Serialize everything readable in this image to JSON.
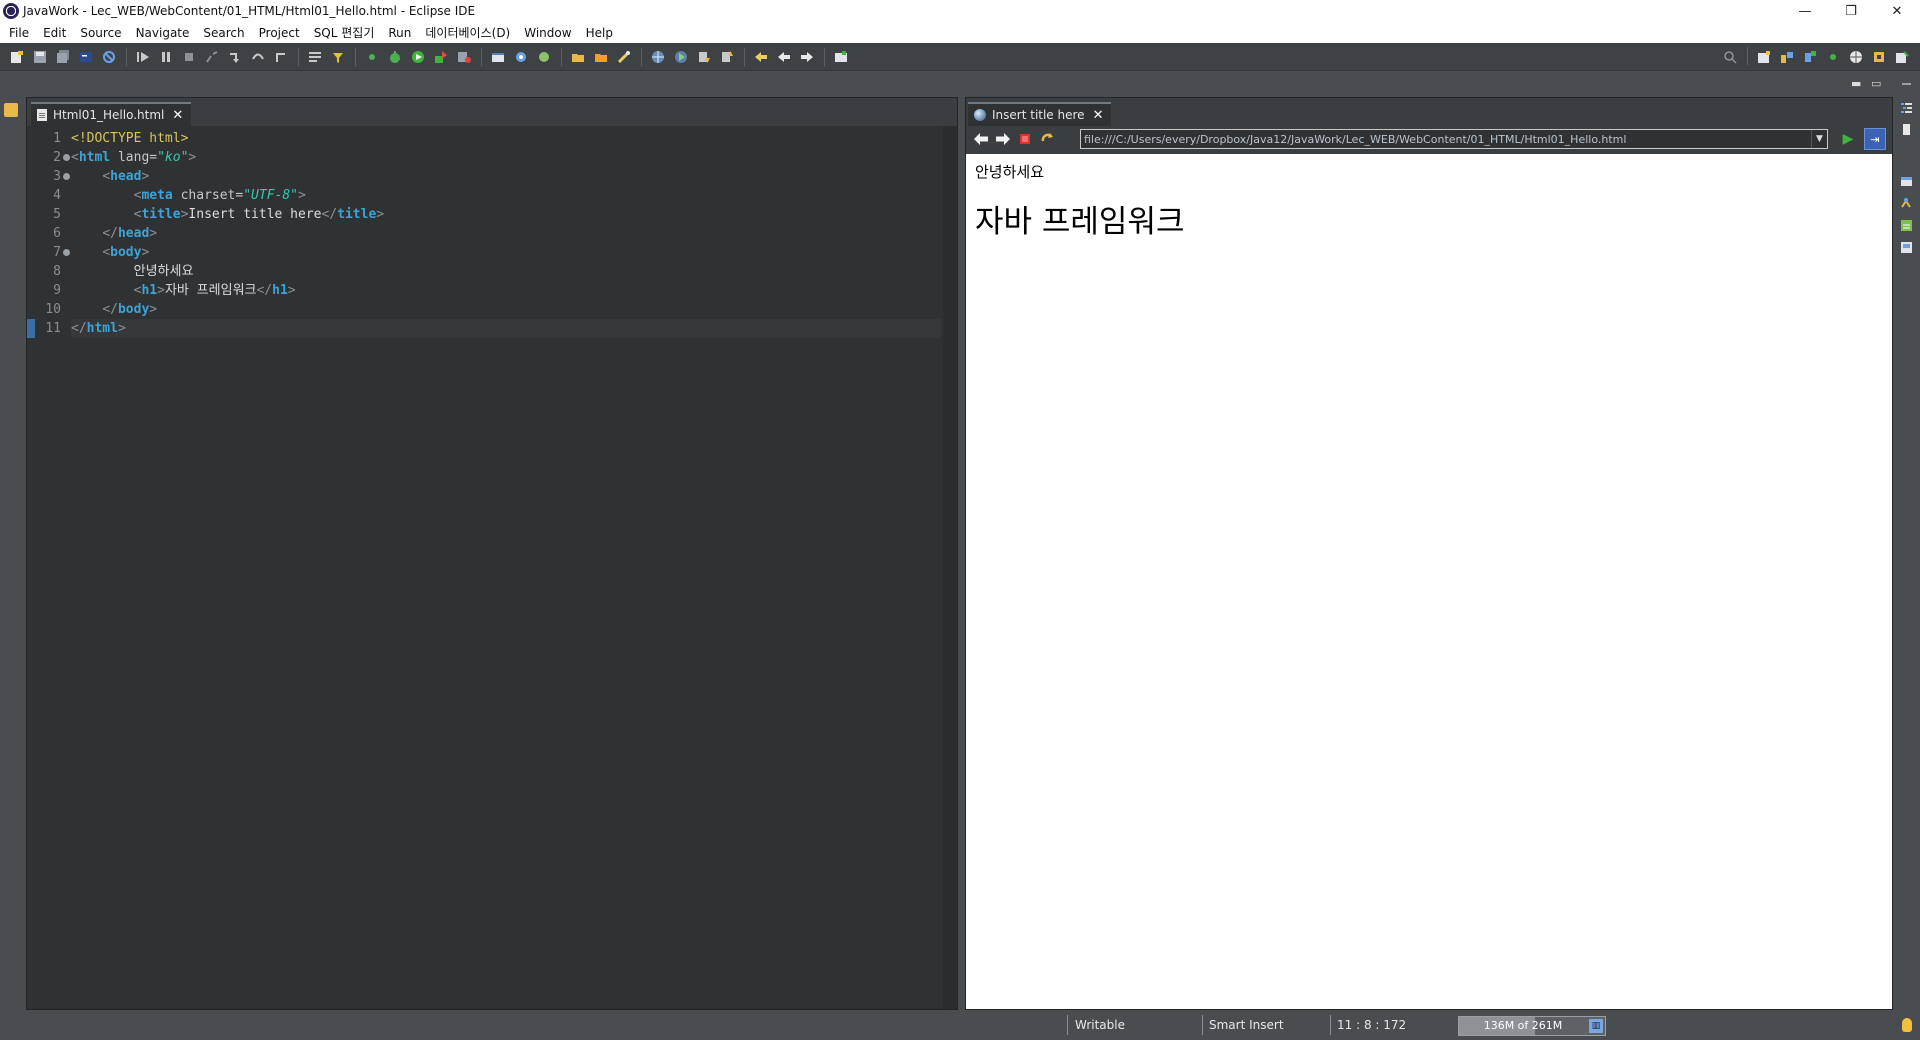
{
  "window": {
    "title": "JavaWork - Lec_WEB/WebContent/01_HTML/Html01_Hello.html - Eclipse IDE",
    "minimize": "—",
    "restore": "❐",
    "close": "✕"
  },
  "menu": {
    "items": [
      "File",
      "Edit",
      "Source",
      "Navigate",
      "Search",
      "Project",
      "SQL 편집기",
      "Run",
      "데이터베이스(D)",
      "Window",
      "Help"
    ]
  },
  "editor": {
    "tab_label": "Html01_Hello.html",
    "line_numbers": [
      "1",
      "2",
      "3",
      "4",
      "5",
      "6",
      "7",
      "8",
      "9",
      "10",
      "11"
    ],
    "current_line": 11,
    "lines": [
      {
        "indent": "",
        "tokens": [
          {
            "c": "t-doc",
            "t": "<!DOCTYPE "
          },
          {
            "c": "t-doc",
            "t": "html"
          },
          {
            "c": "t-doc",
            "t": ">"
          }
        ]
      },
      {
        "indent": "",
        "tokens": [
          {
            "c": "t-br",
            "t": "<"
          },
          {
            "c": "t-tag",
            "t": "html"
          },
          {
            "c": "t-attr",
            "t": " lang="
          },
          {
            "c": "t-val",
            "t": "\"ko\""
          },
          {
            "c": "t-br",
            "t": ">"
          }
        ]
      },
      {
        "indent": "    ",
        "tokens": [
          {
            "c": "t-br",
            "t": "<"
          },
          {
            "c": "t-tag",
            "t": "head"
          },
          {
            "c": "t-br",
            "t": ">"
          }
        ]
      },
      {
        "indent": "        ",
        "tokens": [
          {
            "c": "t-br",
            "t": "<"
          },
          {
            "c": "t-tag",
            "t": "meta"
          },
          {
            "c": "t-attr",
            "t": " charset="
          },
          {
            "c": "t-val",
            "t": "\"UTF-8\""
          },
          {
            "c": "t-br",
            "t": ">"
          }
        ]
      },
      {
        "indent": "        ",
        "tokens": [
          {
            "c": "t-br",
            "t": "<"
          },
          {
            "c": "t-tag",
            "t": "title"
          },
          {
            "c": "t-br",
            "t": ">"
          },
          {
            "c": "t-txt",
            "t": "Insert title here"
          },
          {
            "c": "t-br",
            "t": "</"
          },
          {
            "c": "t-tag",
            "t": "title"
          },
          {
            "c": "t-br",
            "t": ">"
          }
        ]
      },
      {
        "indent": "    ",
        "tokens": [
          {
            "c": "t-br",
            "t": "</"
          },
          {
            "c": "t-tag",
            "t": "head"
          },
          {
            "c": "t-br",
            "t": ">"
          }
        ]
      },
      {
        "indent": "    ",
        "tokens": [
          {
            "c": "t-br",
            "t": "<"
          },
          {
            "c": "t-tag",
            "t": "body"
          },
          {
            "c": "t-br",
            "t": ">"
          }
        ]
      },
      {
        "indent": "        ",
        "tokens": [
          {
            "c": "t-txt",
            "t": "안녕하세요"
          }
        ]
      },
      {
        "indent": "        ",
        "tokens": [
          {
            "c": "t-br",
            "t": "<"
          },
          {
            "c": "t-tag",
            "t": "h1"
          },
          {
            "c": "t-br",
            "t": ">"
          },
          {
            "c": "t-txt",
            "t": "자바 프레임워크"
          },
          {
            "c": "t-br",
            "t": "</"
          },
          {
            "c": "t-tag",
            "t": "h1"
          },
          {
            "c": "t-br",
            "t": ">"
          }
        ]
      },
      {
        "indent": "    ",
        "tokens": [
          {
            "c": "t-br",
            "t": "</"
          },
          {
            "c": "t-tag",
            "t": "body"
          },
          {
            "c": "t-br",
            "t": ">"
          }
        ]
      },
      {
        "indent": "",
        "tokens": [
          {
            "c": "t-br",
            "t": "</"
          },
          {
            "c": "t-tag",
            "t": "html"
          },
          {
            "c": "t-br",
            "t": ">"
          }
        ]
      }
    ]
  },
  "browser": {
    "tab_label": "Insert title here",
    "url": "file:///C:/Users/every/Dropbox/Java12/JavaWork/Lec_WEB/WebContent/01_HTML/Html01_Hello.html",
    "page_paragraph": "안녕하세요",
    "page_heading": "자바 프레임워크"
  },
  "status": {
    "writable": "Writable",
    "insert_mode": "Smart Insert",
    "position": "11 : 8 : 172",
    "heap": "136M of 261M",
    "heap_used_fraction": 0.52
  },
  "colors": {
    "editor_bg": "#2f3133",
    "tag": "#3ea3d6",
    "attr_value": "#36c9b0",
    "doctype": "#d7c65a"
  }
}
